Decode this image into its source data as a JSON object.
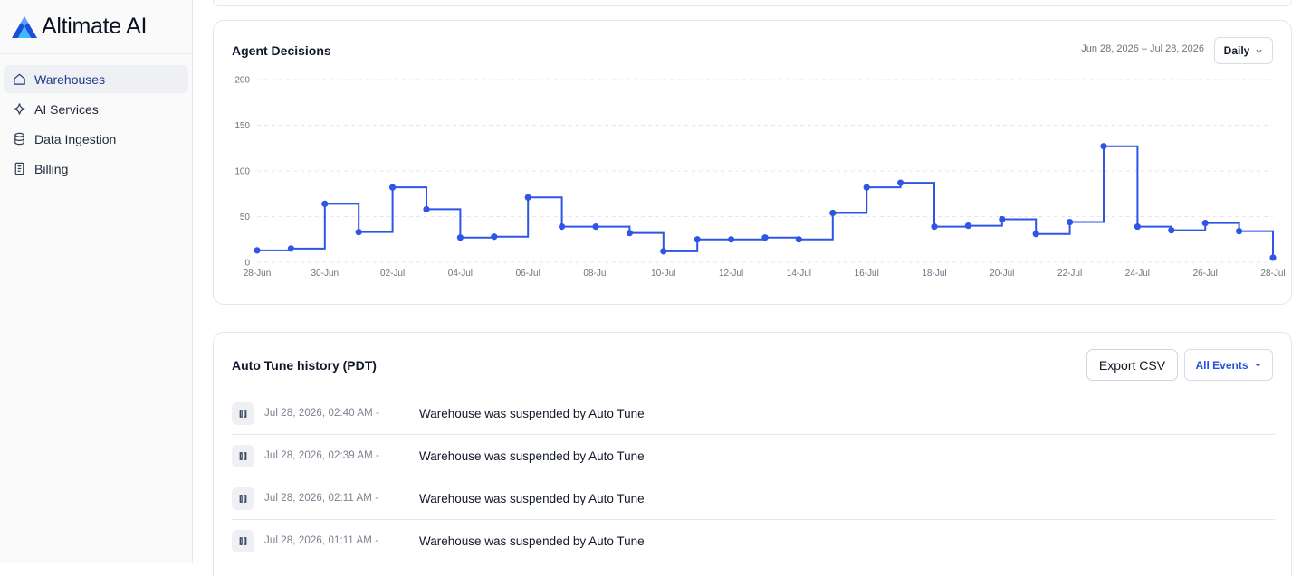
{
  "brand": {
    "name": "Altimate AI"
  },
  "sidebar": {
    "items": [
      {
        "label": "Warehouses",
        "icon": "home-icon",
        "active": true
      },
      {
        "label": "AI Services",
        "icon": "sparkle-icon",
        "active": false
      },
      {
        "label": "Data Ingestion",
        "icon": "database-icon",
        "active": false
      },
      {
        "label": "Billing",
        "icon": "receipt-icon",
        "active": false
      }
    ]
  },
  "decisions": {
    "title": "Agent Decisions",
    "date_range": "Jun 28, 2026 – Jul 28, 2026",
    "granularity": "Daily"
  },
  "history": {
    "title": "Auto Tune history (PDT)",
    "export_label": "Export CSV",
    "filter_label": "All Events",
    "rows": [
      {
        "time": "Jul 28, 2026, 02:40 AM -",
        "message": "Warehouse was suspended by Auto Tune",
        "icon": "pause-icon"
      },
      {
        "time": "Jul 28, 2026, 02:39 AM -",
        "message": "Warehouse was suspended by Auto Tune",
        "icon": "pause-icon"
      },
      {
        "time": "Jul 28, 2026, 02:11 AM -",
        "message": "Warehouse was suspended by Auto Tune",
        "icon": "pause-icon"
      },
      {
        "time": "Jul 28, 2026, 01:11 AM -",
        "message": "Warehouse was suspended by Auto Tune",
        "icon": "pause-icon"
      }
    ]
  },
  "colors": {
    "accent": "#2f55e6",
    "grid": "#e5e7eb",
    "axis_text": "#6b7280"
  },
  "chart_data": {
    "type": "line",
    "step": true,
    "title": "Agent Decisions",
    "xlabel": "",
    "ylabel": "",
    "ylim": [
      0,
      200
    ],
    "yticks": [
      0,
      50,
      100,
      150,
      200
    ],
    "grid": true,
    "x": [
      "28-Jun",
      "29-Jun",
      "30-Jun",
      "01-Jul",
      "02-Jul",
      "03-Jul",
      "04-Jul",
      "05-Jul",
      "06-Jul",
      "07-Jul",
      "08-Jul",
      "09-Jul",
      "10-Jul",
      "11-Jul",
      "12-Jul",
      "13-Jul",
      "14-Jul",
      "15-Jul",
      "16-Jul",
      "17-Jul",
      "18-Jul",
      "19-Jul",
      "20-Jul",
      "21-Jul",
      "22-Jul",
      "23-Jul",
      "24-Jul",
      "25-Jul",
      "26-Jul",
      "27-Jul",
      "28-Jul"
    ],
    "xtick_labels": [
      "28-Jun",
      "30-Jun",
      "02-Jul",
      "04-Jul",
      "06-Jul",
      "08-Jul",
      "10-Jul",
      "12-Jul",
      "14-Jul",
      "16-Jul",
      "18-Jul",
      "20-Jul",
      "22-Jul",
      "24-Jul",
      "26-Jul",
      "28-Jul"
    ],
    "values": [
      13,
      15,
      64,
      33,
      82,
      58,
      27,
      28,
      71,
      39,
      39,
      32,
      12,
      25,
      25,
      27,
      25,
      54,
      82,
      87,
      39,
      40,
      47,
      31,
      44,
      127,
      39,
      35,
      43,
      34,
      5
    ]
  }
}
